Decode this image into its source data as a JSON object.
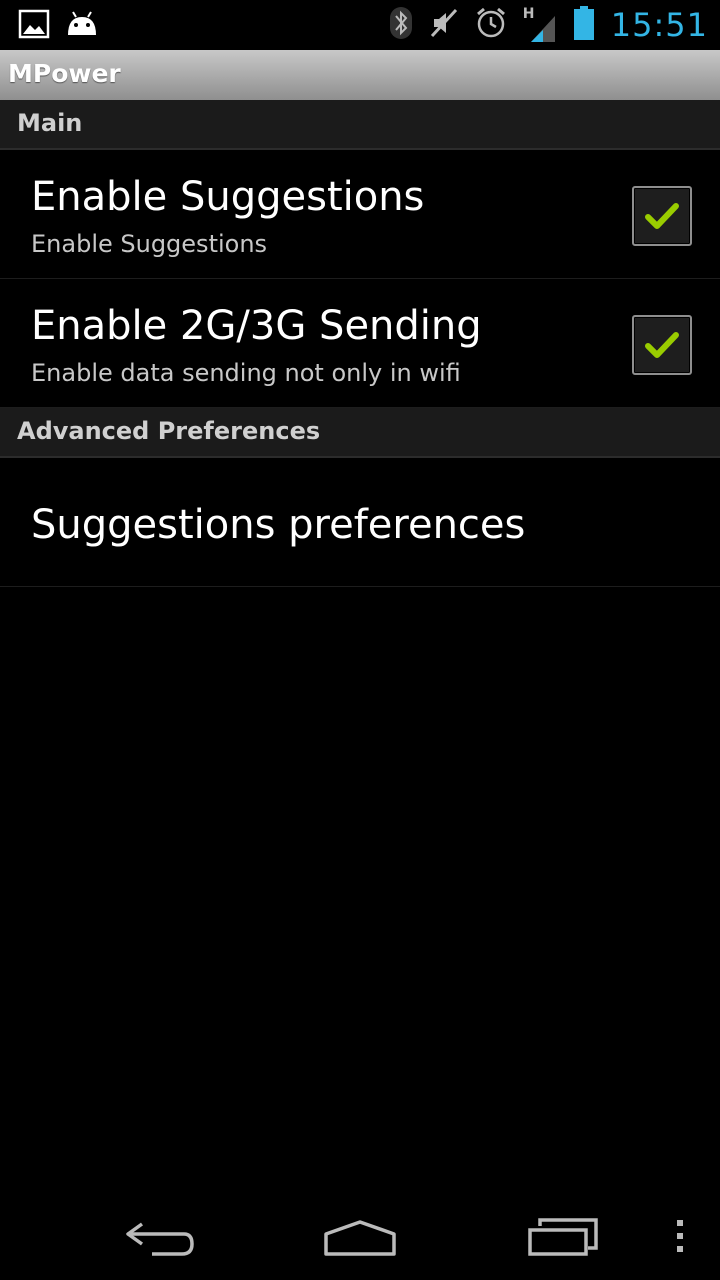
{
  "status_bar": {
    "left_icons": [
      "picture-icon",
      "android-debug-icon"
    ],
    "right_icons": [
      "bluetooth-icon",
      "muted-icon",
      "alarm-icon",
      "signal-h-icon",
      "battery-icon"
    ],
    "network_type": "H",
    "clock": "15:51",
    "clock_color": "#33b5e5"
  },
  "app": {
    "title": "MPower"
  },
  "categories": [
    {
      "label": "Main",
      "items": [
        {
          "title": "Enable Suggestions",
          "summary": "Enable Suggestions",
          "checked": true
        },
        {
          "title": "Enable 2G/3G Sending",
          "summary": "Enable data sending not only in wifi",
          "checked": true
        }
      ]
    },
    {
      "label": "Advanced Preferences",
      "items": [
        {
          "title": "Suggestions preferences"
        }
      ]
    }
  ],
  "nav_bar": {
    "buttons": [
      "back-icon",
      "home-icon",
      "recent-apps-icon",
      "overflow-menu-icon"
    ]
  },
  "colors": {
    "accent": "#33b5e5",
    "check": "#99cc00",
    "background": "#000000"
  }
}
